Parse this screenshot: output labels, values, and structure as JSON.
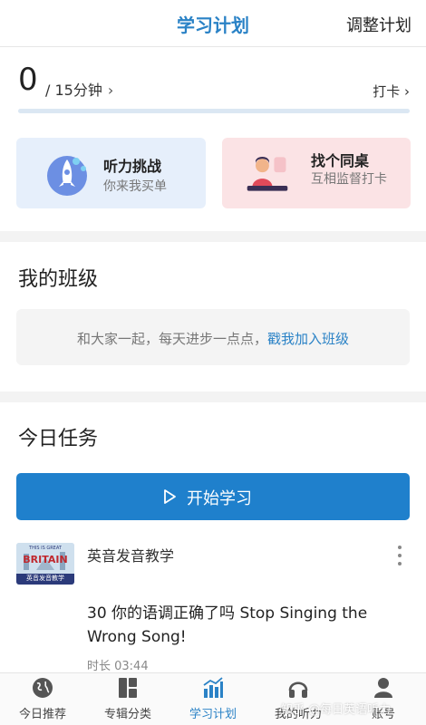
{
  "header": {
    "title": "学习计划",
    "adjust_label": "调整计划"
  },
  "progress": {
    "minutes": "0",
    "target": "/ 15分钟",
    "chevron": "›",
    "checkin_label": "打卡 ›",
    "fraction": 0.0
  },
  "cards": [
    {
      "title": "听力挑战",
      "subtitle": "你来我买单",
      "icon": "rocket-icon",
      "bg": "#e6effb"
    },
    {
      "title": "找个同桌",
      "subtitle": "互相监督打卡",
      "icon": "study-partner-icon",
      "bg": "#fbe3e5"
    }
  ],
  "my_class": {
    "title": "我的班级",
    "text": "和大家一起，每天进步一点点，",
    "link": "戳我加入班级"
  },
  "today": {
    "title": "今日任务",
    "start_label": "开始学习"
  },
  "task": {
    "channel": "英音发音教学",
    "title": "30 你的语调正确了吗 Stop Singing the Wrong Song!",
    "duration": "时长 03:44",
    "thumb_line1": "THIS IS GREAT",
    "thumb_line2": "BRITAIN",
    "thumb_line3": "英音发音教学"
  },
  "nav": [
    {
      "label": "今日推荐",
      "icon": "globe-icon"
    },
    {
      "label": "专辑分类",
      "icon": "album-grid-icon"
    },
    {
      "label": "学习计划",
      "icon": "chart-icon",
      "active": true
    },
    {
      "label": "我的听力",
      "icon": "headphones-icon"
    },
    {
      "label": "账号",
      "icon": "user-icon"
    }
  ],
  "watermark": "知乎 @每日英语听力",
  "colors": {
    "accent": "#2a82c6",
    "button": "#1f80cc"
  }
}
